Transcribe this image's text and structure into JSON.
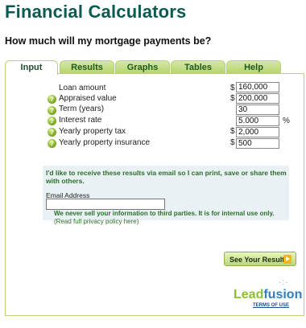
{
  "app_title": "Financial Calculators",
  "question": "How much will my mortgage payments be?",
  "tabs": [
    {
      "label": "Input",
      "active": true
    },
    {
      "label": "Results",
      "active": false
    },
    {
      "label": "Graphs",
      "active": false
    },
    {
      "label": "Tables",
      "active": false
    },
    {
      "label": "Help",
      "active": false
    }
  ],
  "form": {
    "loan_amount": {
      "label": "Loan amount",
      "value": "160,000",
      "prefix": "$"
    },
    "appraised_value": {
      "label": "Appraised value",
      "value": "200,000",
      "prefix": "$"
    },
    "term": {
      "label": "Term (years)",
      "value": "30"
    },
    "interest_rate": {
      "label": "Interest rate",
      "value": "5.000",
      "suffix": "%"
    },
    "property_tax": {
      "label": "Yearly property tax",
      "value": "2,000",
      "prefix": "$"
    },
    "property_insurance": {
      "label": "Yearly property insurance",
      "value": "500",
      "prefix": "$"
    }
  },
  "email": {
    "message": "I'd like to receive these results via email so I can print, save or share them with others.",
    "label": "Email Address",
    "value": "",
    "privacy_text": "We never sell your information to third parties. It is for internal use only.",
    "privacy_link": "(Read full privacy policy here)"
  },
  "button": {
    "see_results": "See Your Results"
  },
  "branding": {
    "lead": "Lead",
    "fusion": "fusion",
    "terms": "TERMS OF USE"
  },
  "icons": {
    "help": "help-question-icon",
    "arrow": "arrow-right-icon"
  },
  "colors": {
    "title": "#0b5a52",
    "tab_green": "#b5d36a",
    "accent": "#f1b41c",
    "email_bg": "#eaf1f5"
  }
}
